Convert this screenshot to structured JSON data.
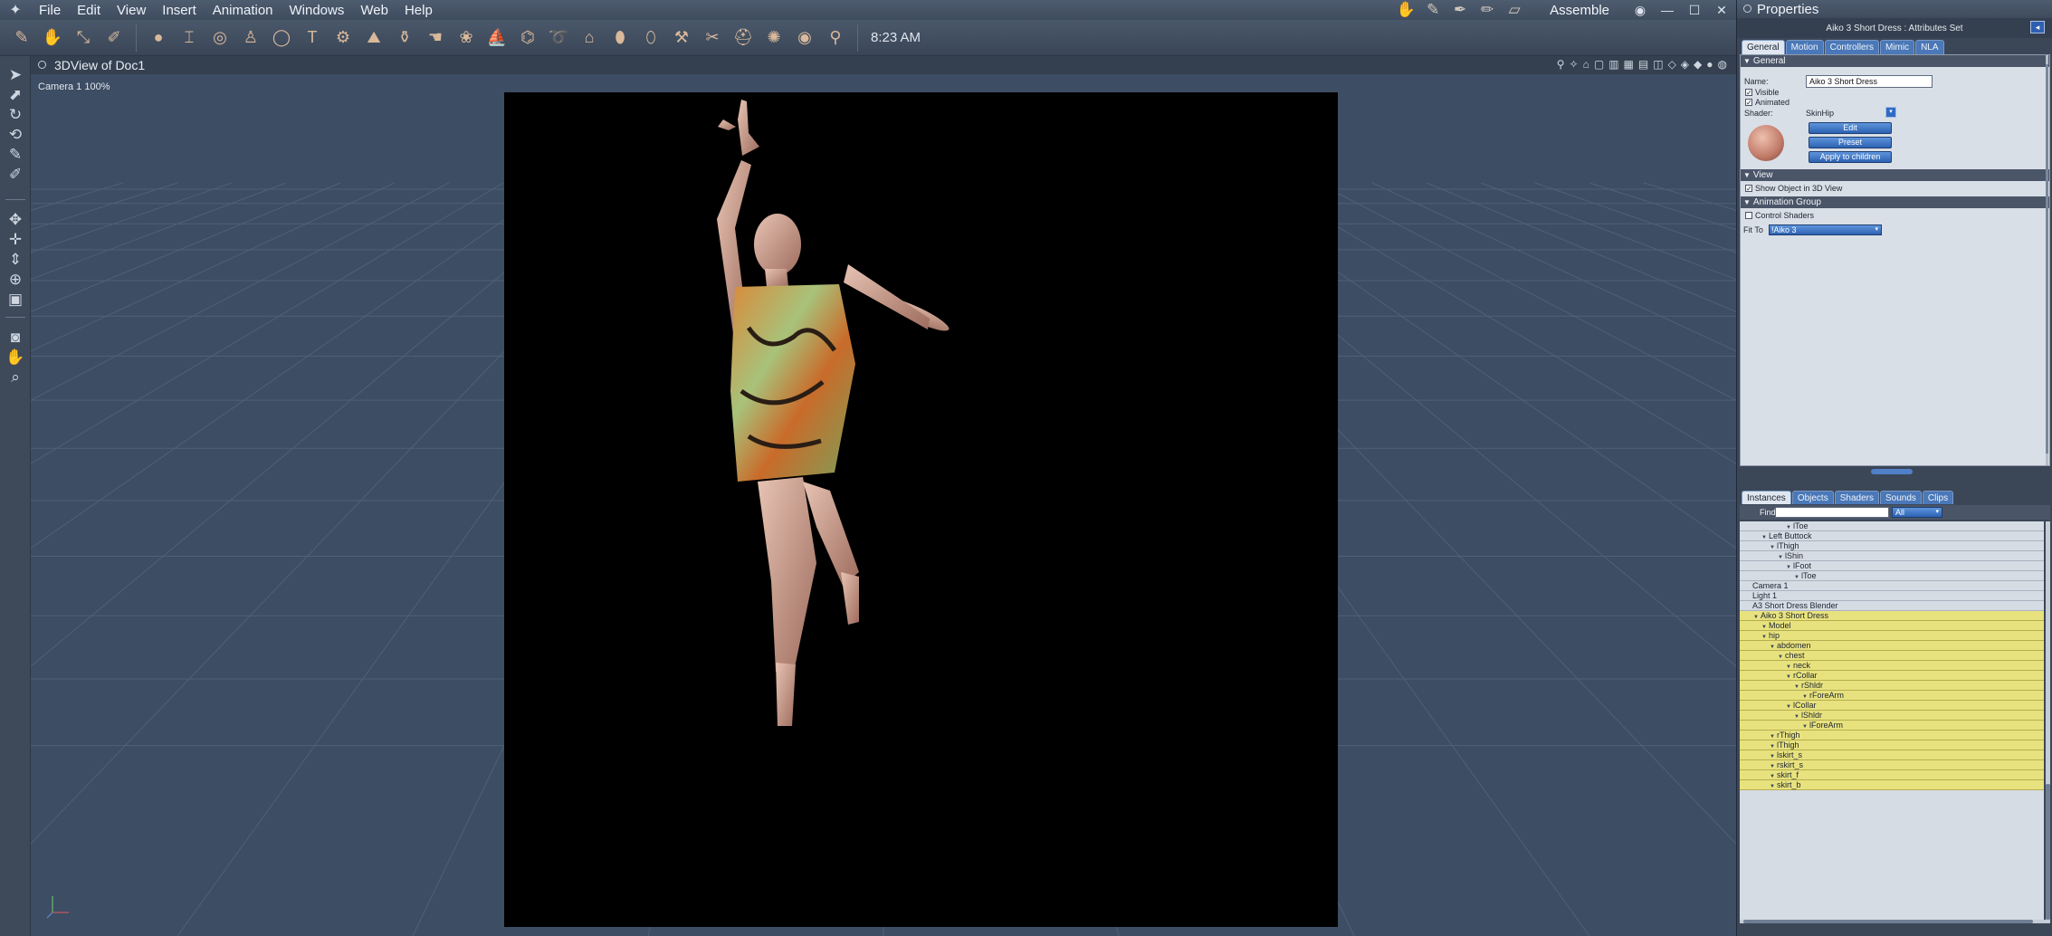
{
  "menubar": {
    "items": [
      "File",
      "Edit",
      "View",
      "Insert",
      "Animation",
      "Windows",
      "Web",
      "Help"
    ],
    "room": "Assemble",
    "room_icons": [
      "hand-icon",
      "brush-icon",
      "pen-icon",
      "pencil-icon",
      "ruler-icon"
    ]
  },
  "toolbar": {
    "clock": "8:23 AM",
    "tool_icons": [
      "paintbrush-icon",
      "move-tool-icon",
      "scale-tool-icon",
      "poser-icon",
      "sphere-icon",
      "i-beam-icon",
      "ring-icon",
      "figure-icon",
      "torus-icon",
      "text-icon",
      "gear-icon",
      "terrain-icon",
      "vase-icon",
      "hand-icon",
      "bush-icon",
      "ship-icon",
      "ago-icon",
      "rope-icon",
      "house-icon",
      "rock-icon",
      "boot-icon",
      "hammer-icon",
      "scissors-icon",
      "hat-icon",
      "bug-icon",
      "target-icon",
      "wrench-icon"
    ]
  },
  "viewport": {
    "title": "3DView of Doc1",
    "camera_label": "Camera 1 100%"
  },
  "properties": {
    "title": "Properties",
    "subtitle": "Aiko 3 Short Dress : Attributes Set",
    "tabs": [
      "General",
      "Motion",
      "Controllers",
      "Mimic",
      "NLA"
    ],
    "active_tab": "General",
    "general_header": "General",
    "name_label": "Name:",
    "name_value": "Aiko 3 Short Dress",
    "visible_label": "Visible",
    "visible_checked": true,
    "animated_label": "Animated",
    "animated_checked": true,
    "shader_label": "Shader:",
    "shader_value": "SkinHip",
    "edit_button": "Edit",
    "preset_button": "Preset",
    "apply_children_button": "Apply to children",
    "view_header": "View",
    "show_object_label": "Show Object in 3D View",
    "show_object_checked": true,
    "anim_group_header": "Animation Group",
    "control_shaders_label": "Control Shaders",
    "control_shaders_checked": false,
    "fit_to_label": "Fit To",
    "fit_to_value": "!Aiko 3"
  },
  "instances": {
    "tabs": [
      "Instances",
      "Objects",
      "Shaders",
      "Sounds",
      "Clips"
    ],
    "active_tab": "Instances",
    "find_label": "Find:",
    "find_value": "",
    "filter_value": "All",
    "rows": [
      {
        "label": "lToe",
        "depth": 5,
        "highlight": false
      },
      {
        "label": "Left Buttock",
        "depth": 2,
        "highlight": false
      },
      {
        "label": "lThigh",
        "depth": 3,
        "highlight": false
      },
      {
        "label": "lShin",
        "depth": 4,
        "highlight": false
      },
      {
        "label": "lFoot",
        "depth": 5,
        "highlight": false
      },
      {
        "label": "lToe",
        "depth": 6,
        "highlight": false
      },
      {
        "label": "Camera 1",
        "depth": 0,
        "highlight": false
      },
      {
        "label": "Light 1",
        "depth": 0,
        "highlight": false
      },
      {
        "label": "A3 Short Dress Blender",
        "depth": 0,
        "highlight": false
      },
      {
        "label": "Aiko 3 Short Dress",
        "depth": 1,
        "highlight": true
      },
      {
        "label": "Model",
        "depth": 2,
        "highlight": true
      },
      {
        "label": "hip",
        "depth": 2,
        "highlight": true
      },
      {
        "label": "abdomen",
        "depth": 3,
        "highlight": true
      },
      {
        "label": "chest",
        "depth": 4,
        "highlight": true
      },
      {
        "label": "neck",
        "depth": 5,
        "highlight": true
      },
      {
        "label": "rCollar",
        "depth": 5,
        "highlight": true
      },
      {
        "label": "rShldr",
        "depth": 6,
        "highlight": true
      },
      {
        "label": "rForeArm",
        "depth": 7,
        "highlight": true
      },
      {
        "label": "lCollar",
        "depth": 5,
        "highlight": true
      },
      {
        "label": "lShldr",
        "depth": 6,
        "highlight": true
      },
      {
        "label": "lForeArm",
        "depth": 7,
        "highlight": true
      },
      {
        "label": "rThigh",
        "depth": 3,
        "highlight": true
      },
      {
        "label": "lThigh",
        "depth": 3,
        "highlight": true
      },
      {
        "label": "lskirt_s",
        "depth": 3,
        "highlight": true
      },
      {
        "label": "rskirt_s",
        "depth": 3,
        "highlight": true
      },
      {
        "label": "skirt_f",
        "depth": 3,
        "highlight": true
      },
      {
        "label": "skirt_b",
        "depth": 3,
        "highlight": true
      }
    ]
  },
  "colors": {
    "accent_blue": "#2d62b2",
    "highlight_yellow": "#e8e27e",
    "viewport_bg": "#3d4d63"
  }
}
